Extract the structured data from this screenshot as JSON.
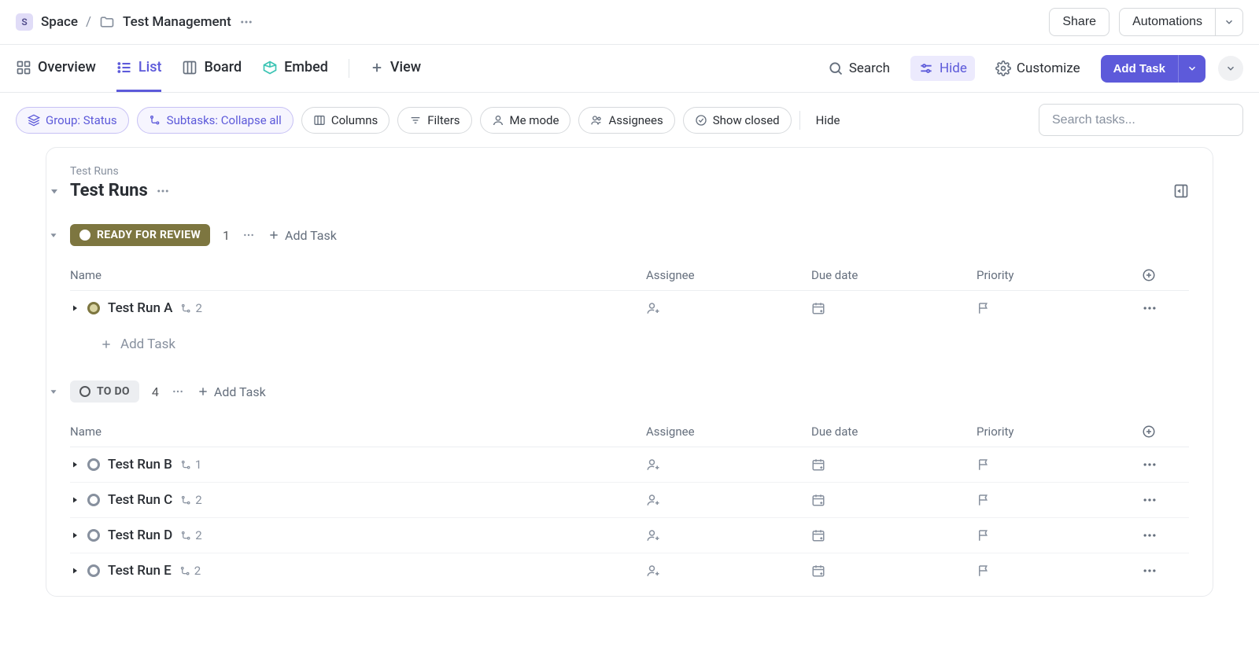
{
  "breadcrumb": {
    "space_initial": "S",
    "space_label": "Space",
    "folder_label": "Test Management"
  },
  "topbar": {
    "share_label": "Share",
    "automations_label": "Automations"
  },
  "viewtabs": {
    "overview": "Overview",
    "list": "List",
    "board": "Board",
    "embed": "Embed",
    "add_view": "View"
  },
  "viewbar": {
    "search": "Search",
    "hide": "Hide",
    "customize": "Customize",
    "add_task": "Add Task"
  },
  "filterbar": {
    "group": "Group: Status",
    "subtasks": "Subtasks: Collapse all",
    "columns": "Columns",
    "filters": "Filters",
    "me_mode": "Me mode",
    "assignees": "Assignees",
    "show_closed": "Show closed",
    "hide": "Hide",
    "search_placeholder": "Search tasks..."
  },
  "panel": {
    "sub": "Test Runs",
    "title": "Test Runs"
  },
  "columns": {
    "name": "Name",
    "assignee": "Assignee",
    "due": "Due date",
    "priority": "Priority"
  },
  "groups": [
    {
      "status_key": "review",
      "status_label": "READY FOR REVIEW",
      "count": "1",
      "add_label": "Add Task",
      "tasks": [
        {
          "title": "Test Run A",
          "sub": "2",
          "status": "review"
        }
      ],
      "footer_add": "Add Task"
    },
    {
      "status_key": "todo",
      "status_label": "TO DO",
      "count": "4",
      "add_label": "Add Task",
      "tasks": [
        {
          "title": "Test Run B",
          "sub": "1",
          "status": "todo"
        },
        {
          "title": "Test Run C",
          "sub": "2",
          "status": "todo"
        },
        {
          "title": "Test Run D",
          "sub": "2",
          "status": "todo"
        },
        {
          "title": "Test Run E",
          "sub": "2",
          "status": "todo"
        }
      ]
    }
  ]
}
